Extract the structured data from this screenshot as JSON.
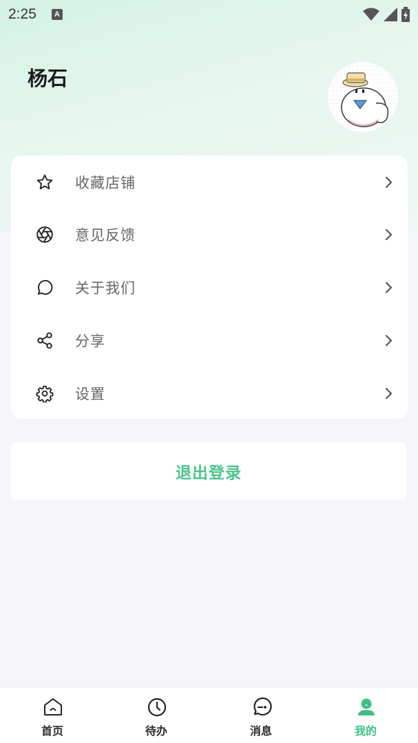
{
  "status_bar": {
    "time": "2:25",
    "notification_badge": "A"
  },
  "profile": {
    "username": "杨石"
  },
  "menu": {
    "items": [
      {
        "label": "收藏店铺",
        "icon": "star-icon"
      },
      {
        "label": "意见反馈",
        "icon": "aperture-icon"
      },
      {
        "label": "关于我们",
        "icon": "chat-bubble-icon"
      },
      {
        "label": "分享",
        "icon": "share-icon"
      },
      {
        "label": "设置",
        "icon": "gear-icon"
      }
    ]
  },
  "logout": {
    "label": "退出登录"
  },
  "tabbar": {
    "tabs": [
      {
        "label": "首页",
        "icon": "home-icon",
        "active": false
      },
      {
        "label": "待办",
        "icon": "clock-icon",
        "active": false
      },
      {
        "label": "消息",
        "icon": "message-icon",
        "active": false
      },
      {
        "label": "我的",
        "icon": "user-icon",
        "active": true
      }
    ]
  },
  "colors": {
    "accent": "#3fbf84",
    "header_gradient_start": "#d3f2e4",
    "page_bg": "#f6f6fa"
  }
}
